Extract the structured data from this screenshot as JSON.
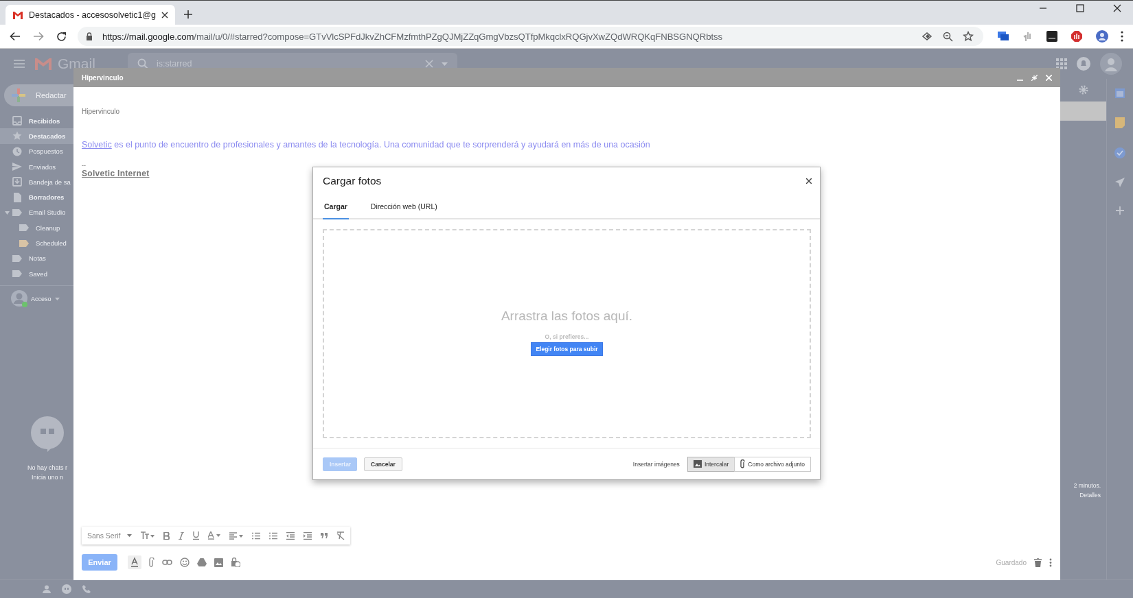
{
  "browser": {
    "tab_title": "Destacados - accesosolvetic1@g",
    "url_host": "https://mail.google.com",
    "url_path": "/mail/u/0/#starred?compose=GTvVlcSPFdJkvZhCFMzfmthPZgQJMjZZqGmgVbzsQTfpMkqclxRQGjvXwZQdWRQKqFNBSGNQRbtss"
  },
  "gmail": {
    "logo_text": "Gmail",
    "search_value": "is:starred",
    "compose_button": "Redactar",
    "sidebar": [
      {
        "label": "Recibidos",
        "kind": "inbox",
        "bold": true,
        "selected": false
      },
      {
        "label": "Destacados",
        "kind": "star",
        "bold": true,
        "selected": true
      },
      {
        "label": "Pospuestos",
        "kind": "clock",
        "bold": false,
        "selected": false
      },
      {
        "label": "Enviados",
        "kind": "send",
        "bold": false,
        "selected": false
      },
      {
        "label": "Bandeja de sa",
        "kind": "download",
        "bold": false,
        "selected": false
      },
      {
        "label": "Borradores",
        "kind": "draft",
        "bold": true,
        "selected": false
      },
      {
        "label": "Email Studio",
        "kind": "label",
        "bold": false,
        "selected": false,
        "expanded": true,
        "children": [
          {
            "label": "Cleanup",
            "kind": "label",
            "bold": false,
            "selected": false
          },
          {
            "label": "Scheduled",
            "kind": "label",
            "bold": false,
            "selected": false,
            "color": "#d8c3a5"
          }
        ]
      },
      {
        "label": "Notas",
        "kind": "label",
        "bold": false,
        "selected": false
      },
      {
        "label": "Saved",
        "kind": "label",
        "bold": false,
        "selected": false
      }
    ],
    "account_label": "Acceso",
    "chats_empty": [
      "No hay chats r",
      "Inicia uno n"
    ],
    "activity": "2 minutos.",
    "details_link": "Detalles"
  },
  "compose": {
    "title": "Hipervinculo",
    "body_label": "Hipervinculo",
    "body_link": "Solvetic",
    "body_rest": " es el punto de encuentro de profesionales y amantes de la tecnología. Una comunidad que te sorprenderá y ayudará en más de una ocasión",
    "signature_separator": "--",
    "signature": "Solvetic Internet",
    "font_name": "Sans Serif",
    "send_button": "Enviar",
    "saved_status": "Guardado"
  },
  "dialog": {
    "title": "Cargar fotos",
    "tabs": [
      {
        "label": "Cargar",
        "selected": true
      },
      {
        "label": "Dirección web (URL)",
        "selected": false
      }
    ],
    "drop_text": "Arrastra las fotos aquí.",
    "or_text": "O, si prefieres...",
    "choose_button": "Elegir fotos para subir",
    "insert_button": {
      "label": "Insertar",
      "disabled": true
    },
    "cancel_button": "Cancelar",
    "insert_images_label": "Insertar imágenes",
    "options": [
      {
        "label": "Intercalar",
        "kind": "inline",
        "selected": true
      },
      {
        "label": "Como archivo adjunto",
        "kind": "attachment",
        "selected": false
      }
    ]
  }
}
